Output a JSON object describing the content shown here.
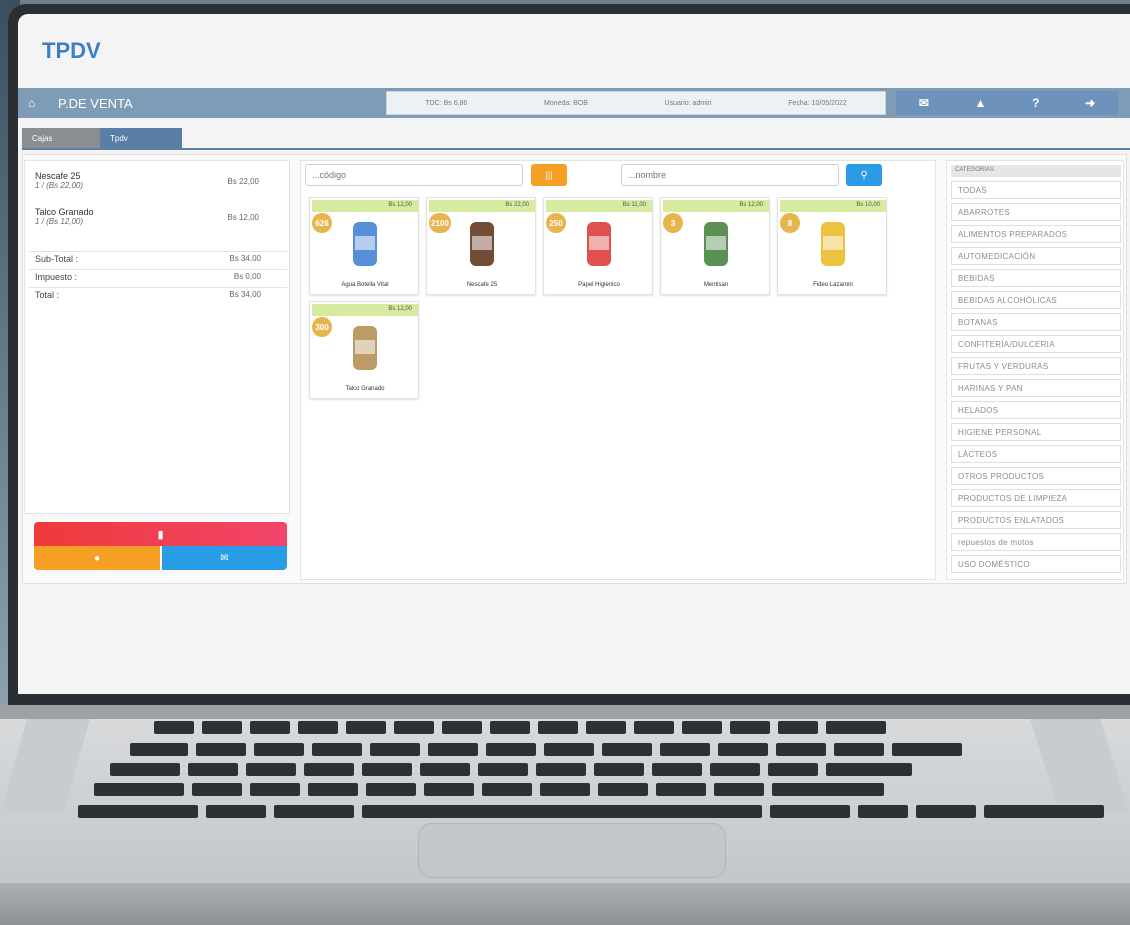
{
  "app": {
    "title": "TPDV"
  },
  "topbar": {
    "section": "P.DE VENTA",
    "tdc": "TDC: Bs 6,86",
    "moneda": "Moneda: BOB",
    "usuario": "Usuario: admin",
    "fecha": "Fecha: 10/05/2022",
    "icons": [
      "mail-icon",
      "bell-icon",
      "help-icon",
      "logout-icon"
    ],
    "help_label": "?"
  },
  "tabs": [
    {
      "label": "Cajas"
    },
    {
      "label": "Tpdv"
    }
  ],
  "cart": {
    "items": [
      {
        "name": "Nescafe 25",
        "detail": "1 / (Bs 22,00)",
        "price": "Bs 22,00"
      },
      {
        "name": "Talco Granado",
        "detail": "1 / (Bs 12,00)",
        "price": "Bs 12,00"
      }
    ],
    "subtotal_label": "Sub-Total :",
    "subtotal": "Bs 34,00",
    "tax_label": "Impuesto :",
    "tax": "Bs 0,00",
    "total_label": "Total :",
    "total": "Bs 34,00"
  },
  "search": {
    "code_placeholder": "...código",
    "name_placeholder": "...nombre",
    "barcode_button": "|||",
    "search_button": "🔍"
  },
  "products": [
    {
      "name": "Agua Botella Vital",
      "price": "Bs 12,00",
      "stock": "626",
      "color": "#3a7bd5"
    },
    {
      "name": "Nescafe 25",
      "price": "Bs 22,00",
      "stock": "2100",
      "color": "#5a2d14"
    },
    {
      "name": "Papel Higienico",
      "price": "Bs 11,00",
      "stock": "250",
      "color": "#d8332e"
    },
    {
      "name": "Mentisan",
      "price": "Bs 12,00",
      "stock": "3",
      "color": "#3e7d36"
    },
    {
      "name": "Fideo Lazaroni",
      "price": "Bs 10,00",
      "stock": "8",
      "color": "#e8b820"
    },
    {
      "name": "Talco Granado",
      "price": "Bs 12,00",
      "stock": "300",
      "color": "#b08a4a"
    }
  ],
  "categories": {
    "header": "CATEGORIAS",
    "items": [
      "TODAS",
      "ABARROTES",
      "ALIMENTOS PREPARADOS",
      "AUTOMEDICACIÓN",
      "BEBIDAS",
      "BEBIDAS ALCOHÓLICAS",
      "BOTANAS",
      "CONFITERÍA/DULCERIA",
      "FRUTAS Y VERDURAS",
      "HARINAS Y PAN",
      "HELADOS",
      "HIGIENE PERSONAL",
      "LÁCTEOS",
      "OTROS PRODUCTOS",
      "PRODUCTOS DE LIMPIEZA",
      "PRODUCTOS ENLATADOS",
      "repuestos de motos",
      "USO DOMÉSTICO"
    ]
  }
}
